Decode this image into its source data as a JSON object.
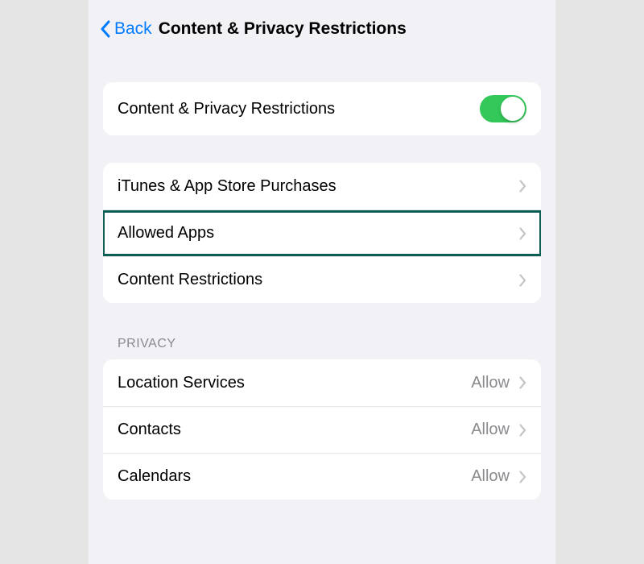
{
  "nav": {
    "back_label": "Back",
    "title": "Content & Privacy Restrictions"
  },
  "toggle_row": {
    "label": "Content & Privacy Restrictions",
    "enabled": true
  },
  "main_group": {
    "items": [
      {
        "label": "iTunes & App Store Purchases"
      },
      {
        "label": "Allowed Apps"
      },
      {
        "label": "Content Restrictions"
      }
    ]
  },
  "privacy_header": "PRIVACY",
  "privacy_group": {
    "items": [
      {
        "label": "Location Services",
        "value": "Allow"
      },
      {
        "label": "Contacts",
        "value": "Allow"
      },
      {
        "label": "Calendars",
        "value": "Allow"
      }
    ]
  },
  "colors": {
    "accent": "#007AFF",
    "toggle_on": "#34C759",
    "highlight": "#0d5f55"
  }
}
